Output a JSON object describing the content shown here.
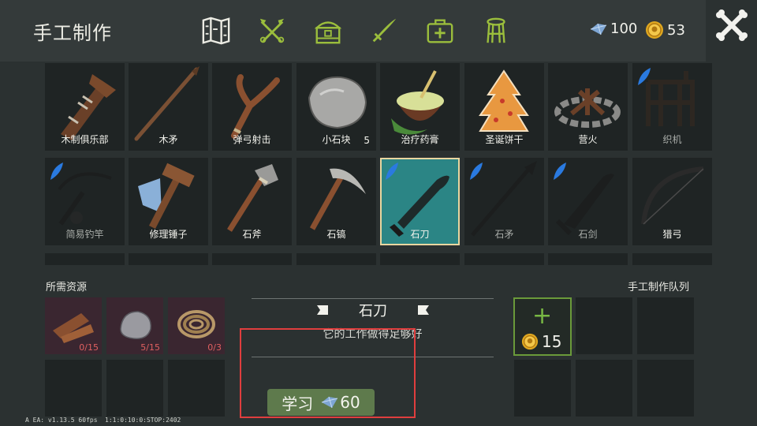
{
  "header": {
    "title": "手工制作",
    "tabs": [
      {
        "icon": "map-icon",
        "active": true
      },
      {
        "icon": "crossed-tools-icon",
        "active": false
      },
      {
        "icon": "chest-icon",
        "active": false
      },
      {
        "icon": "sword-icon",
        "active": false
      },
      {
        "icon": "medkit-icon",
        "active": false
      },
      {
        "icon": "stool-icon",
        "active": false
      }
    ],
    "gems": "100",
    "coins": "53"
  },
  "grid": {
    "row1": [
      {
        "label": "木制俱乐部",
        "icon": "wooden-club-icon"
      },
      {
        "label": "木矛",
        "icon": "wooden-spear-icon"
      },
      {
        "label": "弹弓射击",
        "icon": "slingshot-icon"
      },
      {
        "label": "小石块",
        "icon": "small-stone-icon",
        "qty": "5"
      },
      {
        "label": "治疗药膏",
        "icon": "healing-ointment-icon"
      },
      {
        "label": "圣诞饼干",
        "icon": "christmas-cookie-icon"
      },
      {
        "label": "营火",
        "icon": "campfire-icon"
      },
      {
        "label": "织机",
        "icon": "loom-icon",
        "locked": true
      }
    ],
    "row2": [
      {
        "label": "简易钓竿",
        "icon": "fishing-rod-icon",
        "locked": true
      },
      {
        "label": "修理锤子",
        "icon": "repair-hammer-icon"
      },
      {
        "label": "石斧",
        "icon": "stone-axe-icon"
      },
      {
        "label": "石镐",
        "icon": "stone-pickaxe-icon"
      },
      {
        "label": "石刀",
        "icon": "stone-knife-icon",
        "selected": true
      },
      {
        "label": "石矛",
        "icon": "stone-spear-icon",
        "locked": true
      },
      {
        "label": "石剑",
        "icon": "stone-sword-icon",
        "locked": true
      },
      {
        "label": "猎弓",
        "icon": "hunting-bow-icon"
      }
    ]
  },
  "resources": {
    "title": "所需资源",
    "items": [
      {
        "icon": "wood-icon",
        "count": "0/15"
      },
      {
        "icon": "stone-icon",
        "count": "5/15"
      },
      {
        "icon": "rope-icon",
        "count": "0/3"
      }
    ]
  },
  "detail": {
    "name": "石刀",
    "description": "它的工作做得足够好",
    "learn_label": "学习",
    "learn_cost": "60"
  },
  "queue": {
    "title": "手工制作队列",
    "unlock_cost": "15"
  },
  "footer": {
    "version": "A EA: v1.13.5 60fps",
    "debug": "1:1:0:10:0:STOP:2402"
  },
  "colors": {
    "background": "#2b3131",
    "selected": "#2b8585",
    "learn_button": "#5e7a4c",
    "highlight_box": "#e03e3e",
    "tab_icon": "#9bbe3c"
  }
}
